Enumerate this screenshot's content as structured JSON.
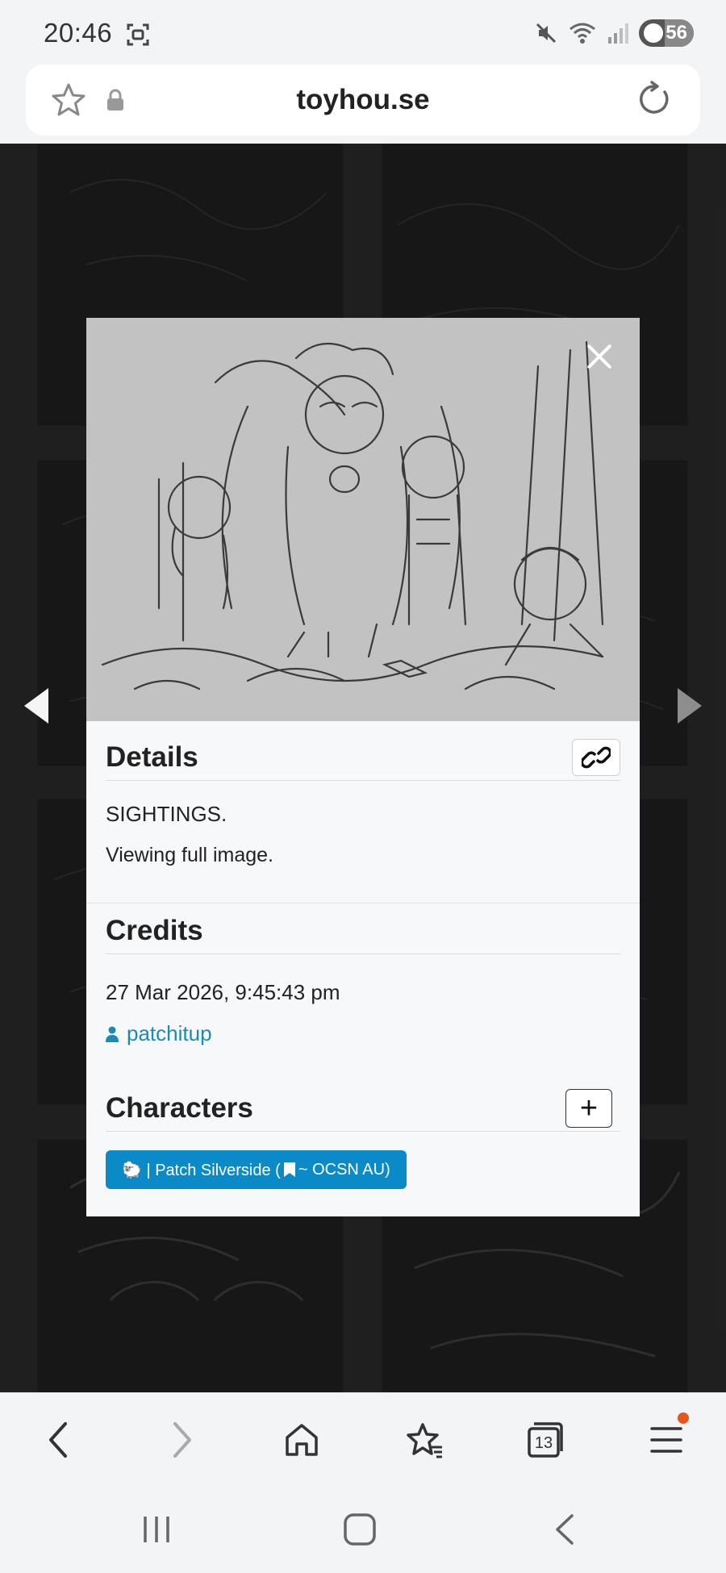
{
  "status_bar": {
    "time": "20:46",
    "battery": "56"
  },
  "browser": {
    "url": "toyhou.se",
    "tab_count": "13"
  },
  "modal": {
    "details": {
      "title": "Details",
      "caption": "SIGHTINGS.",
      "note": "Viewing full image."
    },
    "credits": {
      "title": "Credits",
      "date": "27 Mar 2026, 9:45:43 pm",
      "user": "patchitup"
    },
    "characters": {
      "title": "Characters",
      "items": [
        {
          "prefix": "🐑 | Patch Silverside (",
          "suffix": " ~ OCSN AU)"
        }
      ]
    }
  },
  "colors": {
    "accent": "#0a8bc7",
    "link": "#1a8bb5",
    "notification": "#e8541d"
  }
}
